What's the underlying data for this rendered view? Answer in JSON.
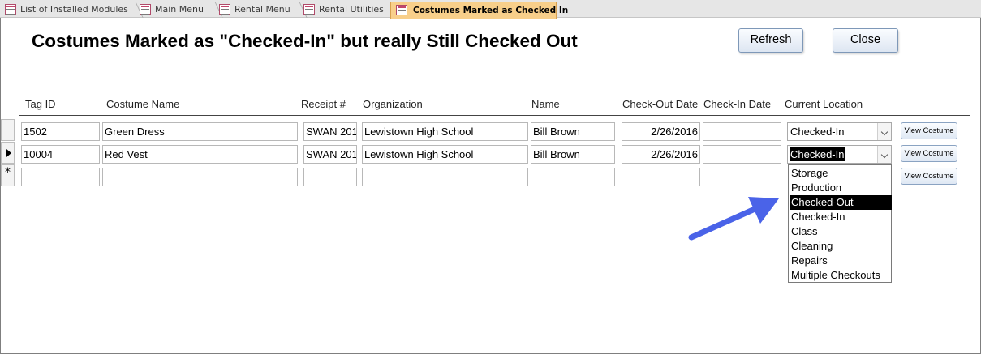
{
  "tabs": [
    {
      "label": "List of Installed Modules",
      "active": false
    },
    {
      "label": "Main Menu",
      "active": false
    },
    {
      "label": "Rental Menu",
      "active": false
    },
    {
      "label": "Rental Utilities",
      "active": false
    },
    {
      "label": "Costumes Marked as Checked In",
      "active": true
    }
  ],
  "form": {
    "title": "Costumes Marked as \"Checked-In\" but really Still Checked Out",
    "refresh_label": "Refresh",
    "close_label": "Close"
  },
  "table": {
    "columns": [
      "Tag ID",
      "Costume Name",
      "Receipt #",
      "Organization",
      "Name",
      "Check-Out Date",
      "Check-In Date",
      "Current Location"
    ],
    "rows": [
      {
        "tag_id": "1502",
        "costume_name": "Green Dress",
        "receipt": "SWAN 201",
        "organization": "Lewistown High School",
        "name": "Bill Brown",
        "checkout_date": "2/26/2016",
        "checkin_date": "",
        "location": "Checked-In",
        "view_label": "View Costume"
      },
      {
        "tag_id": "10004",
        "costume_name": "Red Vest",
        "receipt": "SWAN 201",
        "organization": "Lewistown High School",
        "name": "Bill Brown",
        "checkout_date": "2/26/2016",
        "checkin_date": "",
        "location": "Checked-In",
        "view_label": "View Costume"
      },
      {
        "tag_id": "",
        "costume_name": "",
        "receipt": "",
        "organization": "",
        "name": "",
        "checkout_date": "",
        "checkin_date": "",
        "location": "",
        "view_label": "View Costume"
      }
    ],
    "new_record_marker": "*"
  },
  "location_dropdown": {
    "options": [
      "Storage",
      "Production",
      "Checked-Out",
      "Checked-In",
      "Class",
      "Cleaning",
      "Repairs",
      "Multiple Checkouts"
    ],
    "highlighted": "Checked-Out"
  },
  "colors": {
    "active_tab": "#f8cf8a",
    "arrow": "#4a63e8",
    "selection": "#000000"
  }
}
